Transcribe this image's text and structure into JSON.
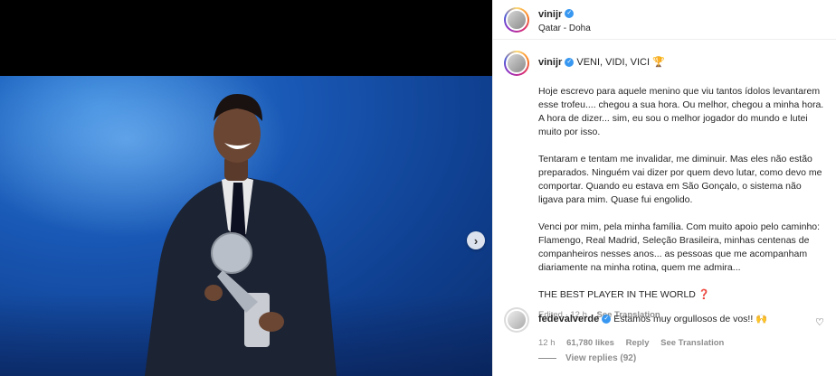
{
  "post": {
    "username": "vinijr",
    "location": "Qatar - Doha",
    "caption_title": "VENI, VIDI, VICI 🏆",
    "caption_paragraphs": [
      "Hoje escrevo para aquele menino que viu tantos ídolos levantarem esse trofeu.... chegou a sua hora. Ou melhor, chegou a minha hora. A hora de dizer... sim, eu sou o melhor jogador do mundo e lutei muito por isso.",
      "Tentaram e tentam me invalidar, me diminuir. Mas eles não estão preparados. Ninguém vai dizer por quem devo lutar, como devo me comportar. Quando eu estava em São Gonçalo, o sistema não ligava para mim. Quase fui engolido.",
      "Venci por mim, pela minha família. Com muito apoio pelo caminho: Flamengo, Real Madrid, Seleção Brasileira, minhas centenas de companheiros nesses anos... as pessoas que me acompanham diariamente na minha rotina, quem me admira...",
      "THE BEST PLAYER IN THE WORLD ❓"
    ],
    "edited": "Edited · 12 h",
    "see_translation": "See Translation"
  },
  "comment": {
    "username": "fedevalverde",
    "text": "Estamos muy orgullosos de vos!! 🙌",
    "time": "12 h",
    "likes": "61,780 likes",
    "reply": "Reply",
    "see_translation": "See Translation",
    "view_replies": "View replies (92)"
  },
  "icons": {
    "verified": "verified-badge-icon",
    "next": "chevron-right-icon",
    "like": "heart-icon"
  },
  "colors": {
    "verified": "#3897f0",
    "muted": "#8e8e8e"
  }
}
